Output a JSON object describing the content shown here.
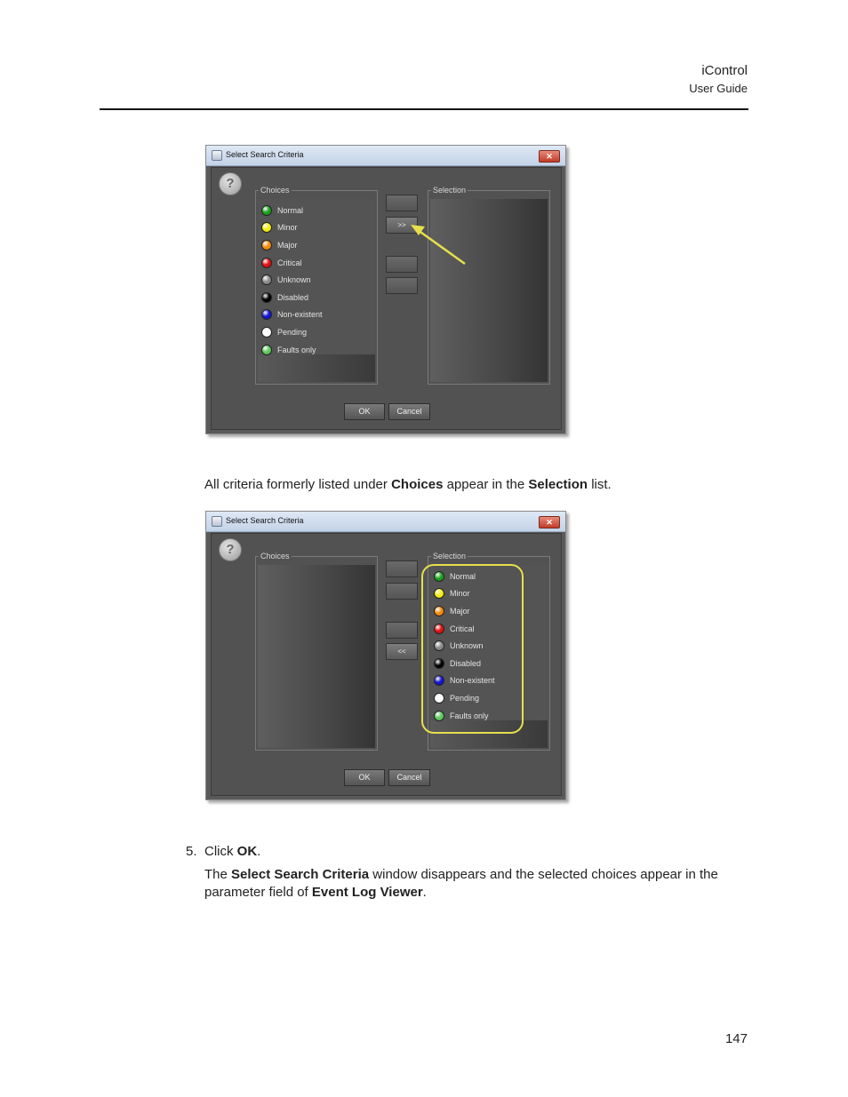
{
  "header": {
    "product": "iControl",
    "subtitle": "User Guide"
  },
  "dialog": {
    "title": "Select Search Criteria",
    "close_label": "✕",
    "choices_label": "Choices",
    "selection_label": "Selection",
    "move_one_right": ">",
    "move_all_right": ">>",
    "move_one_left": "<",
    "move_all_left": "<<",
    "ok_label": "OK",
    "cancel_label": "Cancel",
    "items": [
      {
        "label": "Normal",
        "color": "#1aa01a"
      },
      {
        "label": "Minor",
        "color": "#f2ee10"
      },
      {
        "label": "Major",
        "color": "#f28a0c"
      },
      {
        "label": "Critical",
        "color": "#e01010"
      },
      {
        "label": "Unknown",
        "color": "#8a8a8a"
      },
      {
        "label": "Disabled",
        "color": "#000000"
      },
      {
        "label": "Non-existent",
        "color": "#1414d0"
      },
      {
        "label": "Pending",
        "color": "#ffffff"
      },
      {
        "label": "Faults only",
        "color": "#5ec85e"
      }
    ]
  },
  "caption": {
    "t1": "All criteria formerly listed under ",
    "b1": "Choices",
    "t2": " appear in the ",
    "b2": "Selection",
    "t3": " list."
  },
  "step": {
    "number": "5.",
    "t1": "Click ",
    "b1": "OK",
    "t2": "."
  },
  "para": {
    "t1": "The ",
    "b1": "Select Search Criteria",
    "t2": " window disappears and the selected choices appear in the parameter field of ",
    "b2": "Event Log Viewer",
    "t3": "."
  },
  "page_number": "147"
}
